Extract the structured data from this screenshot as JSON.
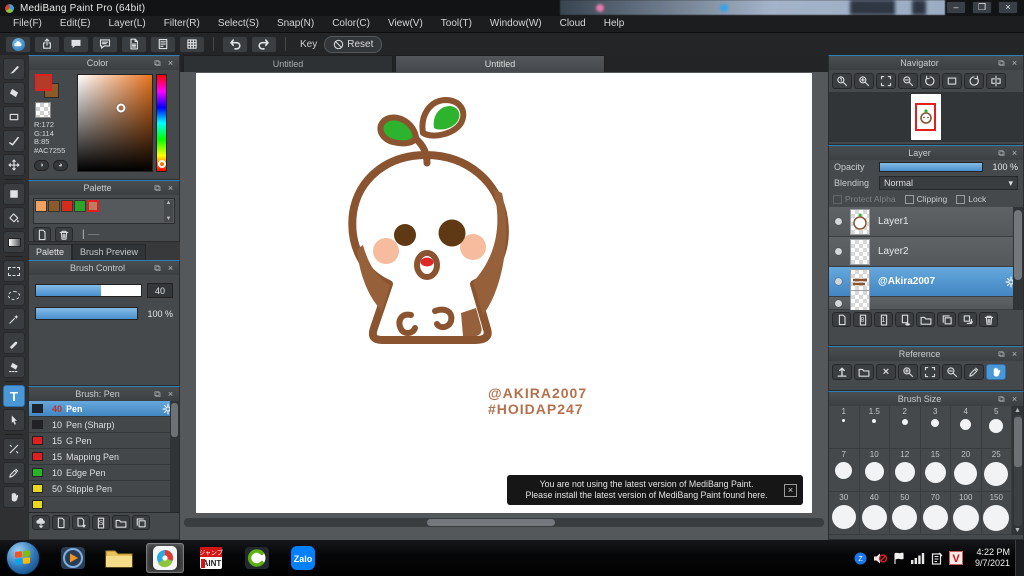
{
  "window": {
    "title": "MediBang Paint Pro (64bit)",
    "controls": [
      "minimize",
      "maximize",
      "close"
    ]
  },
  "menu": {
    "items": [
      "File(F)",
      "Edit(E)",
      "Layer(L)",
      "Filter(R)",
      "Select(S)",
      "Snap(N)",
      "Color(C)",
      "View(V)",
      "Tool(T)",
      "Window(W)",
      "Cloud",
      "Help"
    ]
  },
  "toolbar": {
    "icons": [
      "cloud",
      "publish",
      "comment",
      "chat",
      "document",
      "material",
      "grid-pen"
    ],
    "key_label": "Key",
    "reset_label": "Reset"
  },
  "tools": {
    "items": [
      "brush-tool",
      "eraser-tool",
      "shape-tool",
      "snap-tool",
      "move-tool",
      "fill-tool",
      "bucket-tool",
      "gradient-tool",
      "select-rect-tool",
      "lasso-tool",
      "magic-wand-tool",
      "select-pen-tool",
      "select-eraser-tool",
      "text-tool",
      "operation-tool",
      "divide-tool",
      "eyedropper-tool",
      "hand-tool"
    ],
    "active": "text-tool"
  },
  "color_panel": {
    "title": "Color",
    "r_label": "R:172",
    "g_label": "G:114",
    "b_label": "B:85",
    "hex_label": "#AC7255",
    "foreground": "#b23c28",
    "background_color": "#8b5a2b"
  },
  "palette_panel": {
    "title": "Palette",
    "swatches": [
      {
        "color": "#f2a160",
        "selected": false
      },
      {
        "color": "#8b5a2b",
        "selected": false
      },
      {
        "color": "#d62c1e",
        "selected": false
      },
      {
        "color": "#2aa52a",
        "selected": false
      },
      {
        "color": "#c07a5e",
        "selected": true
      }
    ]
  },
  "panel_tabs": {
    "items": [
      {
        "label": "Palette",
        "active": true
      },
      {
        "label": "Brush Preview",
        "active": false
      }
    ]
  },
  "brush_control": {
    "title": "Brush Control",
    "size_value": "40",
    "size_fraction": 0.62,
    "opacity_value": "100 %",
    "opacity_fraction": 1
  },
  "brush_panel": {
    "title": "Brush: Pen",
    "brushes": [
      {
        "size": "40",
        "name": "Pen",
        "swatch": "#1d2430",
        "selected": true
      },
      {
        "size": "10",
        "name": "Pen (Sharp)",
        "swatch": "#202228",
        "selected": false
      },
      {
        "size": "15",
        "name": "G Pen",
        "swatch": "#e02020",
        "selected": false
      },
      {
        "size": "15",
        "name": "Mapping Pen",
        "swatch": "#e02020",
        "selected": false
      },
      {
        "size": "10",
        "name": "Edge Pen",
        "swatch": "#28b428",
        "selected": false
      },
      {
        "size": "50",
        "name": "Stipple Pen",
        "swatch": "#e8d820",
        "selected": false
      },
      {
        "size": "",
        "name": "",
        "swatch": "#e8d820",
        "selected": false,
        "partial": true
      }
    ],
    "toolbar": [
      "cloud-download-brush",
      "add-brush",
      "add-brush-menu",
      "script-brush",
      "brush-folder",
      "duplicate-brush"
    ]
  },
  "doc_tabs": {
    "items": [
      {
        "label": "Untitled",
        "active": false
      },
      {
        "label": "Untitled",
        "active": true
      }
    ]
  },
  "canvas": {
    "credit_line1": "@AKIRA2007",
    "credit_line2": "#HOIDAP247",
    "ink": "#8a5430",
    "leaf": "#2db32d",
    "cheek": "#f7bb9e",
    "eye": "#5e3913",
    "tongue": "#e02828",
    "shade": "#96613a"
  },
  "notification": {
    "line1": "You are not using the latest version of MediBang Paint.",
    "line2": "Please install the latest version of MediBang Paint found here."
  },
  "navigator": {
    "title": "Navigator",
    "icons": [
      "zoom-actual",
      "zoom-in",
      "fit-screen",
      "zoom-out",
      "rotate-ccw",
      "reset-rotation",
      "rotate-cw",
      "flip-horizontal"
    ]
  },
  "layer_panel": {
    "title": "Layer",
    "opacity_label": "Opacity",
    "opacity_value": "100 %",
    "blending_label": "Blending",
    "blending_value": "Normal",
    "checkboxes": [
      {
        "label": "Protect Alpha",
        "disabled": true
      },
      {
        "label": "Clipping",
        "disabled": false
      },
      {
        "label": "Lock",
        "disabled": false
      }
    ],
    "layers": [
      {
        "name": "Layer1",
        "thumb": "art",
        "selected": false
      },
      {
        "name": "Layer2",
        "thumb": "empty",
        "selected": false
      },
      {
        "name": "@Akira2007",
        "thumb": "text",
        "selected": true
      },
      {
        "name": "",
        "thumb": "empty",
        "selected": false,
        "partial": true
      }
    ],
    "toolbar": [
      "add-layer",
      "add-8bit-layer",
      "add-1bit-layer",
      "add-special-layer",
      "layer-folder",
      "duplicate-layer",
      "transfer-layer",
      "delete-layer"
    ]
  },
  "reference_panel": {
    "title": "Reference",
    "icons": [
      "import-image",
      "open-folder",
      "clear",
      "zoom-in",
      "fit-screen",
      "zoom-out",
      "eyedropper",
      "hand"
    ],
    "active": "hand"
  },
  "brush_size_panel": {
    "title": "Brush Size",
    "sizes": [
      "1",
      "1.5",
      "2",
      "3",
      "4",
      "5",
      "7",
      "10",
      "12",
      "15",
      "20",
      "25",
      "30",
      "40",
      "50",
      "70",
      "100",
      "150"
    ]
  },
  "taskbar": {
    "apps": [
      "start",
      "media-player",
      "explorer",
      "medibang",
      "jump-paint",
      "coc-coc",
      "zalo"
    ],
    "active_app": "medibang",
    "jump_paint_label": "AINT",
    "zalo_label": "Zalo",
    "tray": [
      "zalo-tray",
      "volume-muted",
      "action-center-flag",
      "network",
      "input-indicator",
      "vietkey"
    ],
    "clock_time": "4:22 PM",
    "clock_date": "9/7/2021"
  }
}
